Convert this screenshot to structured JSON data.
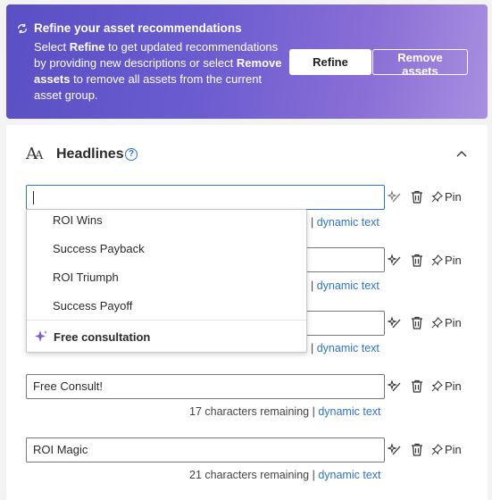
{
  "banner": {
    "title": "Refine your asset recommendations",
    "desc_1": "Select ",
    "desc_refine": "Refine",
    "desc_2": " to get updated recommendations by providing new descriptions or select ",
    "desc_remove": "Remove assets",
    "desc_3": " to remove all assets from the current asset group.",
    "refine_label": "Refine",
    "remove_label": "Remove assets"
  },
  "section": {
    "icon_glyph": "AA",
    "title": "Headlines",
    "help_glyph": "?"
  },
  "fields": [
    {
      "value": "",
      "helper_text": "",
      "link": "dynamic text"
    },
    {
      "value": "",
      "helper_text": "",
      "link": "dynamic text"
    },
    {
      "value": "",
      "helper_text": "",
      "link": "dynamic text"
    },
    {
      "value": "Free Consult!",
      "helper_text": "17 characters remaining",
      "link": "dynamic text"
    },
    {
      "value": "ROI Magic",
      "helper_text": "21 characters remaining",
      "link": "dynamic text"
    }
  ],
  "pin_label": "Pin",
  "separator": "|",
  "dropdown": {
    "items": [
      "ROI Wins",
      "Success Payback",
      "ROI Triumph",
      "Success Payoff"
    ],
    "special": "Free consultation"
  },
  "icons": {
    "banner": "refresh-icon",
    "sparkle": "sparkle-icon",
    "trash": "trash-icon",
    "pin": "pin-icon",
    "collapse": "chevron-up-icon"
  },
  "colors": {
    "accent": "#2f72c8",
    "banner_start": "#5a4fc4",
    "banner_end": "#a98fe0"
  }
}
